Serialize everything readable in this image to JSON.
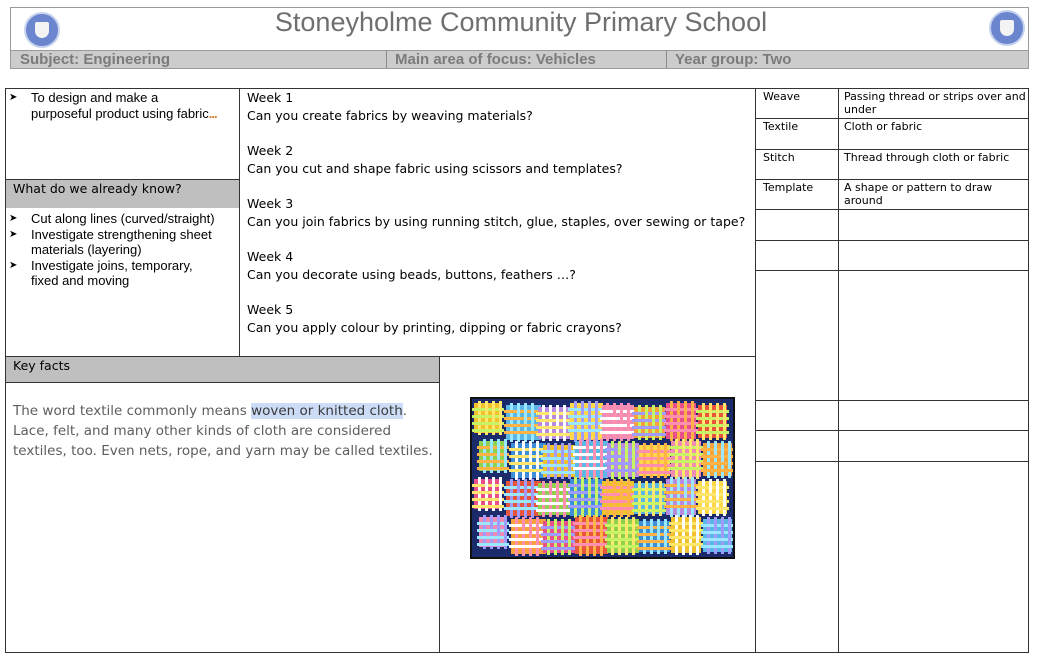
{
  "header": {
    "school_name": "Stoneyholme Community Primary School",
    "subject": "Subject: Engineering",
    "focus": "Main area of focus: Vehicles",
    "year_group": "Year group: Two"
  },
  "objective": {
    "line1": "To design and make a",
    "line2": "purposeful product using fabric"
  },
  "already_know": {
    "heading": "What do we already know?",
    "items": [
      "Cut along lines (curved/straight)",
      "Investigate strengthening sheet",
      "materials (layering)",
      "Investigate joins, temporary,",
      "fixed and moving"
    ]
  },
  "weeks": [
    {
      "label": "Week 1",
      "question": "Can you create fabrics by weaving materials?"
    },
    {
      "label": "Week 2",
      "question": "Can you cut and shape fabric using scissors and templates?"
    },
    {
      "label": "Week 3",
      "question": "Can you join fabrics by using running stitch, glue, staples, over sewing or tape?"
    },
    {
      "label": "Week 4",
      "question": "Can you decorate using beads, buttons, feathers …?"
    },
    {
      "label": "Week 5",
      "question": "Can you apply colour by printing, dipping or fabric crayons?"
    }
  ],
  "key_facts": {
    "heading": "Key facts",
    "text_before": "The word textile commonly means ",
    "highlight": "woven or knitted cloth",
    "text_after": ". Lace, felt, and many other kinds of cloth are considered textiles, too. Even nets, rope, and yarn may be called textiles."
  },
  "vocabulary": [
    {
      "term": "Weave",
      "definition": "Passing thread or strips over and under"
    },
    {
      "term": "Textile",
      "definition": "Cloth or fabric"
    },
    {
      "term": "Stitch",
      "definition": "Thread through cloth or fabric"
    },
    {
      "term": "Template",
      "definition": "A shape or pattern to draw around"
    }
  ],
  "colors": {
    "header_text": "#6f6f6f",
    "info_bar": "#cccccc",
    "section_heading": "#bfbfbf",
    "highlight": "#cddcf6",
    "logo": "#6b86cf"
  }
}
